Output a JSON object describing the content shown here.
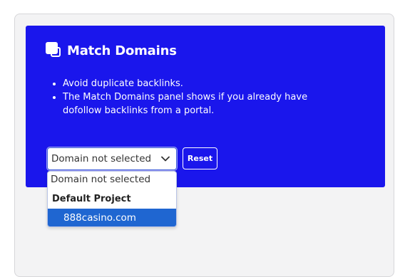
{
  "panel": {
    "title": "Match Domains",
    "icon": "copy-squares-icon",
    "bullets": [
      "Avoid duplicate backlinks.",
      "The Match Domains panel shows if you already have dofollow backlinks from a portal."
    ]
  },
  "domain_select": {
    "selected_label": "Domain not selected",
    "options": {
      "none": "Domain not selected",
      "group_label": "Default Project",
      "items": [
        "888casino.com"
      ]
    }
  },
  "reset_label": "Reset",
  "colors": {
    "panel_bg": "#1a16ec",
    "highlight": "#1f66d1",
    "card_bg": "#f3f3f4"
  }
}
